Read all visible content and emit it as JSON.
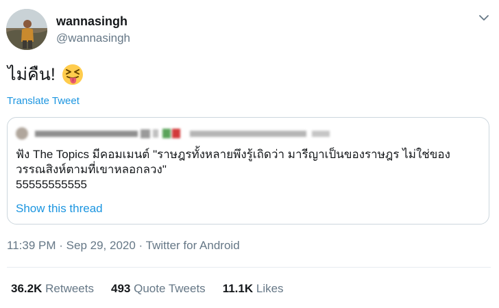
{
  "author": {
    "display_name": "wannasingh",
    "handle": "@wannasingh"
  },
  "tweet": {
    "text": "ไม่คืน!",
    "emoji": "squinting-face-with-tongue"
  },
  "translate_label": "Translate Tweet",
  "quoted_tweet": {
    "line1": "ฟัง The Topics มีคอมเมนต์ \"ราษฎรทั้งหลายพึงรู้เถิดว่า มารีญาเป็นของราษฎร ไม่ใช่ของ",
    "line2": "วรรณสิงห์ตามที่เขาหลอกลวง\"",
    "line3": "55555555555",
    "show_thread": "Show this thread"
  },
  "meta": {
    "time": "11:39 PM",
    "date": "Sep 29, 2020",
    "source": "Twitter for Android",
    "separator": "·"
  },
  "stats": {
    "retweets_count": "36.2K",
    "retweets_label": "Retweets",
    "quotes_count": "493",
    "quotes_label": "Quote Tweets",
    "likes_count": "11.1K",
    "likes_label": "Likes"
  },
  "colors": {
    "link": "#1b95e0",
    "secondary": "#657786",
    "border": "#ccd6dd",
    "emoji_face": "#ffcc4d",
    "tongue": "#e75a70"
  }
}
